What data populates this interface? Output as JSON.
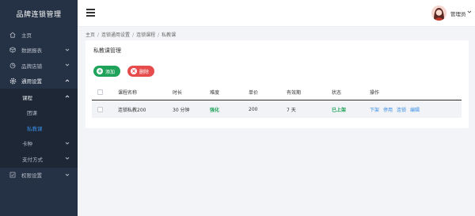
{
  "app": {
    "brand": "品牌连锁管理"
  },
  "sidebar": {
    "items": [
      {
        "label": "主页",
        "icon": "home-icon"
      },
      {
        "label": "数据报表",
        "icon": "cube-icon"
      },
      {
        "label": "品牌店铺",
        "icon": "pie-icon"
      },
      {
        "label": "通用设置",
        "icon": "gear-icon"
      },
      {
        "label": "卡种",
        "icon": "chevron-down-icon"
      },
      {
        "label": "支付方式",
        "icon": "chevron-down-icon"
      },
      {
        "label": "权限设置",
        "icon": "check-square-icon"
      }
    ],
    "sub": {
      "course": "课程",
      "group": "团课",
      "private": "私教课"
    }
  },
  "topbar": {
    "user_name": "管理员"
  },
  "breadcrumb": [
    "主页",
    "连锁通用设置",
    "连锁课程",
    "私教课"
  ],
  "card": {
    "title": "私教课管理",
    "add_label": "添加",
    "delete_label": "删除"
  },
  "table": {
    "headers": [
      "课程名称",
      "时长",
      "难度",
      "单价",
      "有效期",
      "状态",
      "操作"
    ],
    "rows": [
      {
        "name": "连锁私教200",
        "duration": "30 分钟",
        "difficulty": "强化",
        "price": "200",
        "validity": "7 天",
        "status": "已上架",
        "actions": [
          "下架",
          "停用",
          "连锁",
          "编辑"
        ]
      }
    ]
  },
  "colors": {
    "sidebar_bg": "#253144",
    "accent": "#3a8ee6",
    "success": "#1fa25a",
    "danger": "#e64c4c"
  }
}
